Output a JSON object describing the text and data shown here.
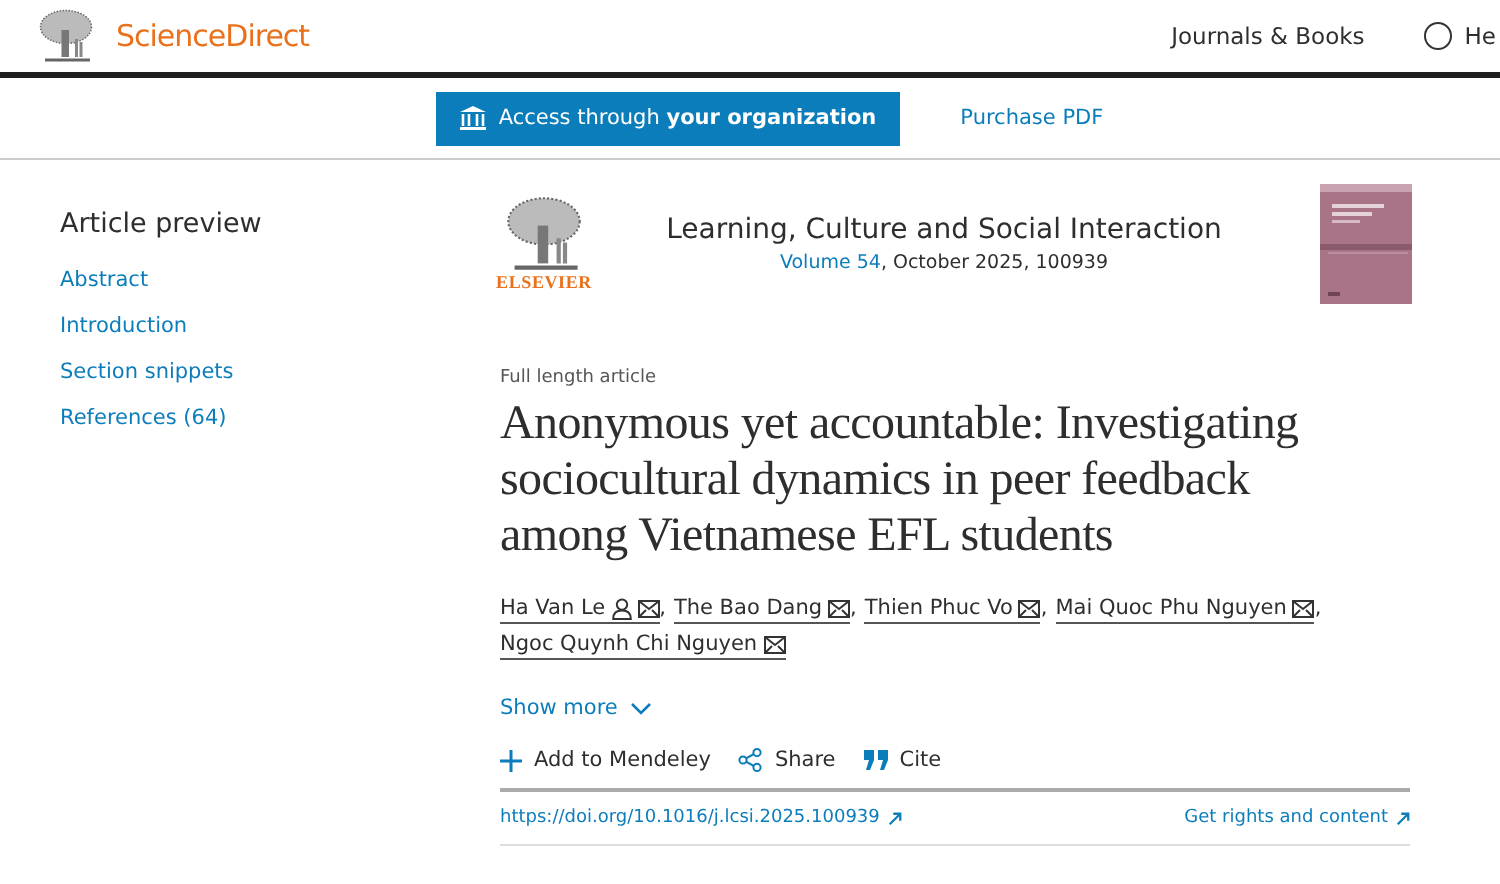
{
  "header": {
    "brand": "ScienceDirect",
    "nav": [
      {
        "label": "Journals & Books",
        "kind": "link"
      },
      {
        "label": "He",
        "kind": "help"
      }
    ]
  },
  "access_bar": {
    "access_button": {
      "prefix": "Access through ",
      "bold": "your organization"
    },
    "purchase": "Purchase PDF"
  },
  "sidebar": {
    "title": "Article preview",
    "items": [
      {
        "label": "Abstract"
      },
      {
        "label": "Introduction"
      },
      {
        "label": "Section snippets"
      },
      {
        "label": "References (64)"
      }
    ]
  },
  "journal": {
    "publisher": "ELSEVIER",
    "name": "Learning, Culture and Social Interaction",
    "volume_link": "Volume 54",
    "details": ", October 2025, 100939"
  },
  "article": {
    "type": "Full length article",
    "title": "Anonymous yet accountable: Investigating sociocultural dynamics in peer feedback among Vietnamese EFL students",
    "authors": [
      {
        "name": "Ha Van Le",
        "profile": true,
        "separator": ","
      },
      {
        "name": "The Bao Dang",
        "profile": false,
        "separator": ","
      },
      {
        "name": "Thien Phuc Vo",
        "profile": false,
        "separator": ","
      },
      {
        "name": "Mai Quoc Phu Nguyen",
        "profile": false,
        "separator": ","
      },
      {
        "name": "Ngoc Quynh Chi Nguyen",
        "profile": false
      }
    ],
    "show_more": "Show more",
    "actions": [
      {
        "label": "Add to Mendeley",
        "kind": "add"
      },
      {
        "label": "Share",
        "kind": "share"
      },
      {
        "label": "Cite",
        "kind": "cite"
      }
    ],
    "doi": "https://doi.org/10.1016/j.lcsi.2025.100939",
    "rights": "Get rights and content"
  }
}
